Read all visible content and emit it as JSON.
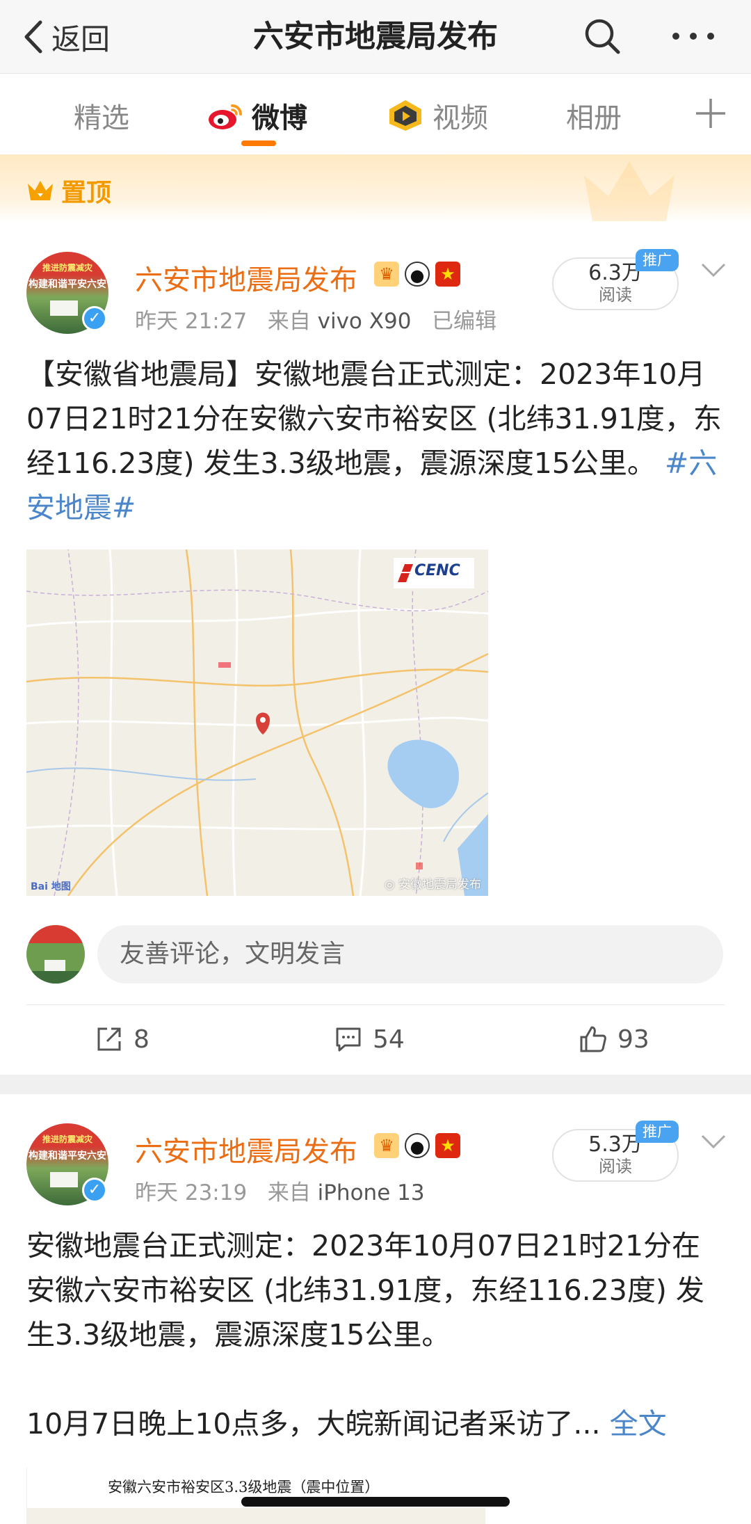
{
  "header": {
    "back_label": "返回",
    "title": "六安市地震局发布"
  },
  "tabs": [
    {
      "label": "精选"
    },
    {
      "label": "微博"
    },
    {
      "label": "视频"
    },
    {
      "label": "相册"
    }
  ],
  "pinned": {
    "label": "置顶"
  },
  "avatar_text": {
    "line1": "推进防震减灾",
    "line2": "构建和谐平安六安"
  },
  "posts": [
    {
      "user_name": "六安市地震局发布",
      "time": "昨天 21:27",
      "source_prefix": "来自",
      "device": "vivo X90",
      "edited": "已编辑",
      "reads_value": "6.3万",
      "reads_label": "阅读",
      "promo": "推广",
      "text": "【安徽省地震局】安徽地震台正式测定：2023年10月07日21时21分在安徽六安市裕安区 (北纬31.91度，东经116.23度) 发生3.3级地震，震源深度15公里。",
      "hashtag": "#六安地震#",
      "map": {
        "badge": "CENC",
        "logo": "Bai 地图",
        "watermark": "◎ 安徽地震局发布"
      },
      "comment_placeholder": "友善评论，文明发言",
      "reposts": "8",
      "comments": "54",
      "likes": "93"
    },
    {
      "user_name": "六安市地震局发布",
      "time": "昨天 23:19",
      "source_prefix": "来自",
      "device": "iPhone 13",
      "reads_value": "5.3万",
      "reads_label": "阅读",
      "promo": "推广",
      "text1": "安徽地震台正式测定：2023年10月07日21时21分在安徽六安市裕安区 (北纬31.91度，东经116.23度) 发生3.3级地震，震源深度15公里。",
      "text2": "10月7日晚上10点多，大皖新闻记者采访了...",
      "more": "全文",
      "map_title": "安徽六安市裕安区3.3级地震（震中位置）"
    }
  ],
  "colors": {
    "accent": "#ff7a00",
    "username": "#eb6e15",
    "link": "#4a86c9",
    "promo": "#4aa3f0"
  }
}
